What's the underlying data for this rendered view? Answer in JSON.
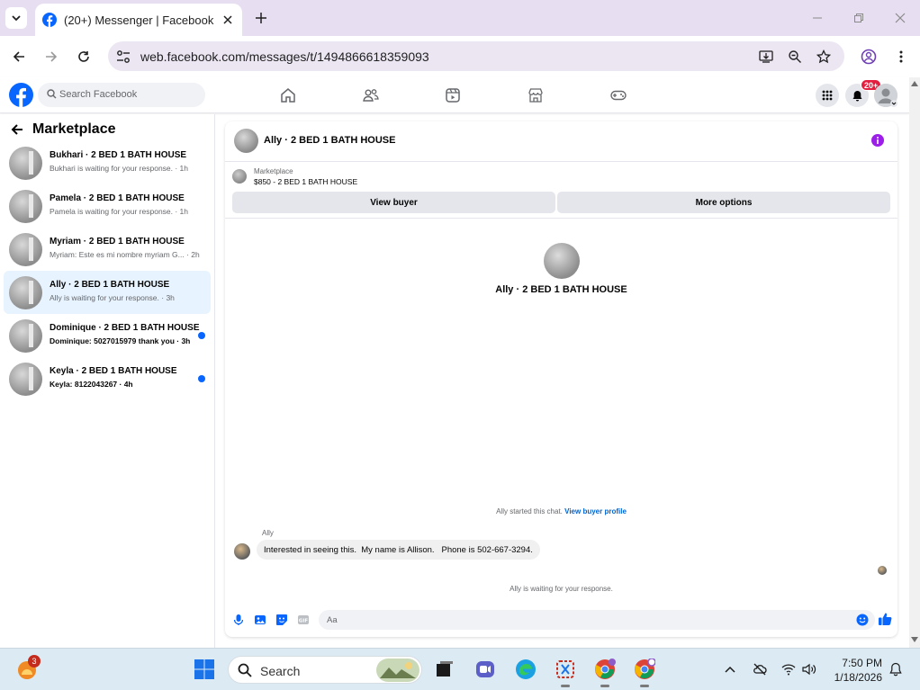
{
  "browser": {
    "tab_title": "(20+) Messenger | Facebook",
    "url": "web.facebook.com/messages/t/1494866618359093"
  },
  "fb": {
    "search_placeholder": "Search Facebook",
    "notification_count": "20+",
    "brand_color": "#0866ff"
  },
  "sidebar": {
    "title": "Marketplace",
    "conversations": [
      {
        "name": "Bukhari · 2 BED 1 BATH HOUSE",
        "preview": "Bukhari is waiting for your response. · 1h",
        "unread": false,
        "active": false
      },
      {
        "name": "Pamela · 2 BED 1 BATH HOUSE",
        "preview": "Pamela is waiting for your response. · 1h",
        "unread": false,
        "active": false
      },
      {
        "name": "Myriam · 2 BED 1 BATH HOUSE",
        "preview": "Myriam: Este es mi nombre myriam G... · 2h",
        "unread": false,
        "active": false
      },
      {
        "name": "Ally · 2 BED 1 BATH HOUSE",
        "preview": "Ally is waiting for your response. · 3h",
        "unread": false,
        "active": true
      },
      {
        "name": "Dominique · 2 BED 1 BATH HOUSE",
        "preview": "Dominique: 5027015979 thank you · 3h",
        "unread": true,
        "active": false
      },
      {
        "name": "Keyla · 2 BED 1 BATH HOUSE",
        "preview": "Keyla: 8122043267 · 4h",
        "unread": true,
        "active": false
      }
    ]
  },
  "chat": {
    "header_title": "Ally · 2 BED 1 BATH HOUSE",
    "marketplace_label": "Marketplace",
    "listing": "$850 - 2 BED 1 BATH HOUSE",
    "view_buyer_label": "View buyer",
    "more_options_label": "More options",
    "center_name": "Ally · 2 BED 1 BATH HOUSE",
    "started_text": "Ally started this chat.",
    "view_profile_label": "View buyer profile",
    "sender_name": "Ally",
    "message": "Interested in seeing this.  My name is Allison.   Phone is 502-667-3294.",
    "waiting_text": "Ally is waiting for your response.",
    "composer_placeholder": "Aa"
  },
  "taskbar": {
    "search_placeholder": "Search",
    "time": "7:50 PM",
    "date": "1/18/2026",
    "app_badge": "3"
  }
}
